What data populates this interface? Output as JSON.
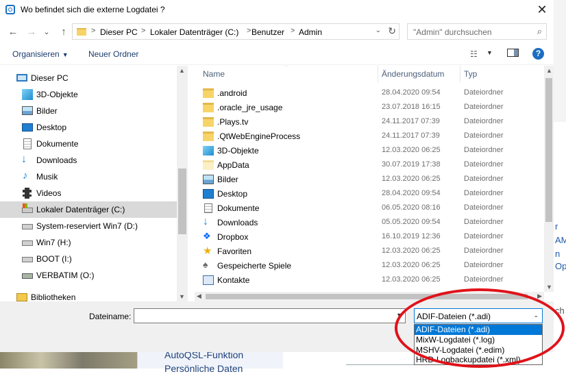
{
  "dialog": {
    "title": "Wo befindet sich die externe Logdatei ?",
    "close_glyph": "✕"
  },
  "nav": {
    "back": "←",
    "forward": "→",
    "dropdown": "⌄",
    "up": "↑",
    "breadcrumbs": [
      "Dieser PC",
      "Lokaler Datenträger (C:)",
      "Benutzer",
      "Admin"
    ],
    "crumb_sep": ">",
    "refresh": "↻",
    "search_placeholder": "\"Admin\" durchsuchen",
    "search_icon": "⌕"
  },
  "toolbar": {
    "organize": "Organisieren",
    "new_folder": "Neuer Ordner",
    "view_glyph": "☷",
    "help": "?"
  },
  "sidebar": {
    "items": [
      {
        "label": "Dieser PC",
        "icon": "computer-icon"
      },
      {
        "label": "3D-Objekte",
        "icon": "cube-icon"
      },
      {
        "label": "Bilder",
        "icon": "pictures-icon"
      },
      {
        "label": "Desktop",
        "icon": "desktop-icon"
      },
      {
        "label": "Dokumente",
        "icon": "documents-icon"
      },
      {
        "label": "Downloads",
        "icon": "download-icon"
      },
      {
        "label": "Musik",
        "icon": "music-icon"
      },
      {
        "label": "Videos",
        "icon": "video-icon"
      },
      {
        "label": "Lokaler Datenträger (C:)",
        "icon": "drive-icon"
      },
      {
        "label": "System-reserviert Win7 (D:)",
        "icon": "drive-icon"
      },
      {
        "label": "Win7 (H:)",
        "icon": "drive-icon"
      },
      {
        "label": "BOOT (I:)",
        "icon": "drive-icon"
      },
      {
        "label": "VERBATIM (O:)",
        "icon": "usb-drive-icon"
      },
      {
        "label": "Bibliotheken",
        "icon": "library-icon"
      }
    ],
    "selected_index": 8
  },
  "filelist": {
    "columns": {
      "name": "Name",
      "date": "Änderungsdatum",
      "type": "Typ"
    },
    "sort_glyph": "^",
    "rows": [
      {
        "name": ".android",
        "date": "28.04.2020 09:54",
        "type": "Dateiordner",
        "icon": "folder-icon"
      },
      {
        "name": ".oracle_jre_usage",
        "date": "23.07.2018 16:15",
        "type": "Dateiordner",
        "icon": "folder-icon"
      },
      {
        "name": ".Plays.tv",
        "date": "24.11.2017 07:39",
        "type": "Dateiordner",
        "icon": "folder-icon"
      },
      {
        "name": ".QtWebEngineProcess",
        "date": "24.11.2017 07:39",
        "type": "Dateiordner",
        "icon": "folder-icon"
      },
      {
        "name": "3D-Objekte",
        "date": "12.03.2020 06:25",
        "type": "Dateiordner",
        "icon": "cube-icon"
      },
      {
        "name": "AppData",
        "date": "30.07.2019 17:38",
        "type": "Dateiordner",
        "icon": "hidden-folder-icon"
      },
      {
        "name": "Bilder",
        "date": "12.03.2020 06:25",
        "type": "Dateiordner",
        "icon": "pictures-icon"
      },
      {
        "name": "Desktop",
        "date": "28.04.2020 09:54",
        "type": "Dateiordner",
        "icon": "desktop-icon"
      },
      {
        "name": "Dokumente",
        "date": "06.05.2020 08:16",
        "type": "Dateiordner",
        "icon": "documents-icon"
      },
      {
        "name": "Downloads",
        "date": "05.05.2020 09:54",
        "type": "Dateiordner",
        "icon": "download-icon"
      },
      {
        "name": "Dropbox",
        "date": "16.10.2019 12:36",
        "type": "Dateiordner",
        "icon": "dropbox-icon"
      },
      {
        "name": "Favoriten",
        "date": "12.03.2020 06:25",
        "type": "Dateiordner",
        "icon": "star-icon"
      },
      {
        "name": "Gespeicherte Spiele",
        "date": "12.03.2020 06:25",
        "type": "Dateiordner",
        "icon": "saved-games-icon"
      },
      {
        "name": "Kontakte",
        "date": "12.03.2020 06:25",
        "type": "Dateiordner",
        "icon": "contacts-icon"
      }
    ]
  },
  "footer": {
    "filename_label": "Dateiname:",
    "filename_value": "",
    "filetype_selected": "ADIF-Dateien (*.adi)",
    "filetype_options": [
      "ADIF-Dateien (*.adi)",
      "MixW-Logdatei (*.log)",
      "MSHV-Logdatei (*.edim)",
      "HRD-Logbackupdatei (*.xml)"
    ],
    "highlighted_option_index": 0
  },
  "background": {
    "side_text": [
      "r",
      "AM",
      "n",
      "Op",
      "ch"
    ],
    "under_text": [
      "AutoQSL-Funktion",
      "Persönliche Daten"
    ]
  },
  "colors": {
    "accent": "#0078d7",
    "annotation_ring": "#e0121a",
    "selection": "#d9d9d9",
    "folder": "#f6d469"
  }
}
